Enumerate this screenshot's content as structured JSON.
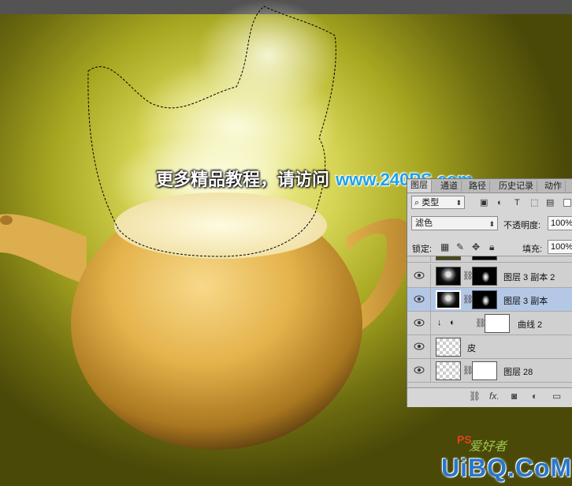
{
  "headline": {
    "cn_text": "更多精品教程，请访问",
    "url_text": "www.240PS.com"
  },
  "panel": {
    "tabs": [
      "图层",
      "通道",
      "路径",
      "历史记录",
      "动作"
    ],
    "filter_kind": "类型",
    "blend_mode": "滤色",
    "opacity_label": "不透明度:",
    "opacity_value": "100%",
    "lock_label": "锁定:",
    "fill_label": "填充:",
    "fill_value": "100%",
    "layers": [
      {
        "name": "图层 3 副本 2",
        "selected": false
      },
      {
        "name": "图层 3 副本",
        "selected": true
      },
      {
        "name": "曲线 2",
        "selected": false
      },
      {
        "name": "皮",
        "selected": false
      },
      {
        "name": "图层 28",
        "selected": false
      }
    ],
    "bottom_icons": [
      "link-icon",
      "fx-icon",
      "mask-icon",
      "adjustment-icon",
      "folder-icon"
    ]
  },
  "watermark": {
    "main": "UiBQ.CoM",
    "small": "爱好者",
    "ps": "PS"
  },
  "colors": {
    "selected_layer": "#b4c8e6",
    "url_blue": "#1fa3ea"
  }
}
